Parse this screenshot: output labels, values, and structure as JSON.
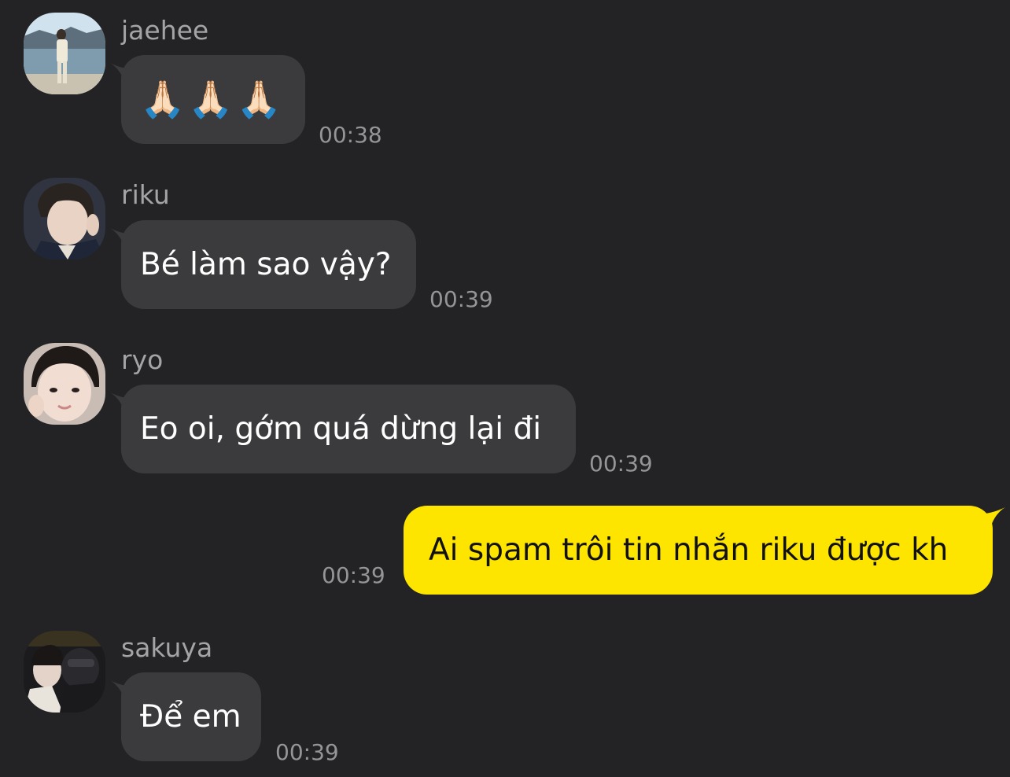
{
  "colors": {
    "background": "#232325",
    "incoming_bubble": "#3b3b3d",
    "outgoing_bubble": "#fee500",
    "name_text": "#a4a4a6",
    "time_text": "#959597"
  },
  "messages": [
    {
      "sender": "jaehee",
      "text": "🙏🏻🙏🏻🙏🏻",
      "time": "00:38",
      "direction": "incoming"
    },
    {
      "sender": "riku",
      "text": "Bé làm sao vậy?",
      "time": "00:39",
      "direction": "incoming"
    },
    {
      "sender": "ryo",
      "text": "Eo oi, gớm quá dừng lại đi",
      "time": "00:39",
      "direction": "incoming"
    },
    {
      "sender": "",
      "text": "Ai spam trôi tin nhắn riku được kh",
      "time": "00:39",
      "direction": "outgoing"
    },
    {
      "sender": "sakuya",
      "text": "Để em",
      "time": "00:39",
      "direction": "incoming"
    }
  ]
}
